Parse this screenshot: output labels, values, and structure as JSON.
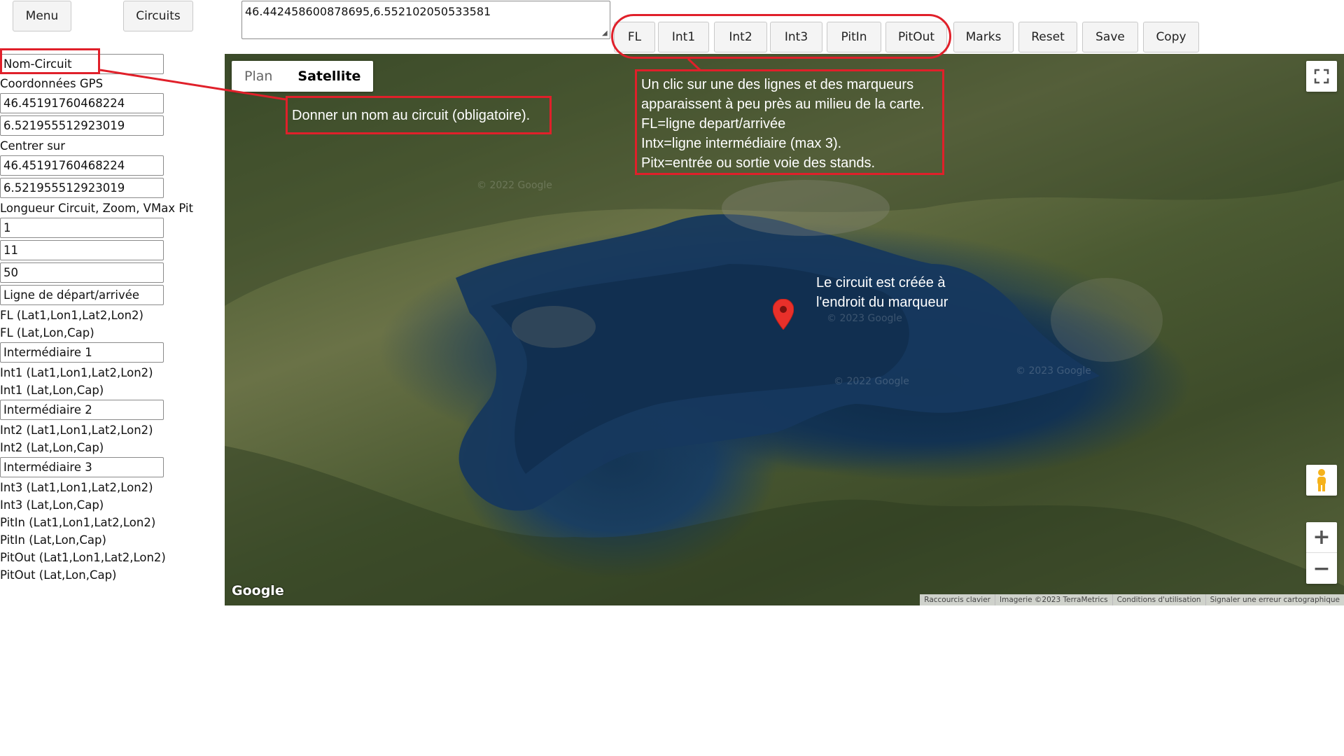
{
  "top_bar": {
    "menu_label": "Menu",
    "circuits_label": "Circuits",
    "coords_value": "46.442458600878695,6.552102050533581",
    "line_buttons": [
      "FL",
      "Int1",
      "Int2",
      "Int3",
      "PitIn",
      "PitOut"
    ],
    "action_buttons": [
      "Marks",
      "Reset",
      "Save",
      "Copy"
    ]
  },
  "sidebar": {
    "name_field": "Nom-Circuit",
    "gps_label": "Coordonnées GPS",
    "gps_lat": "46.45191760468224",
    "gps_lon": "6.521955512923019",
    "center_label": "Centrer sur",
    "center_lat": "46.45191760468224",
    "center_lon": "6.521955512923019",
    "params_label": "Longueur Circuit, Zoom, VMax Pit",
    "length": "1",
    "zoom": "11",
    "vmax": "50",
    "fl_field": "Ligne de départ/arrivée",
    "fl_line": "FL (Lat1,Lon1,Lat2,Lon2)",
    "fl_point": "FL (Lat,Lon,Cap)",
    "int1_field": "Intermédiaire 1",
    "int1_line": "Int1 (Lat1,Lon1,Lat2,Lon2)",
    "int1_point": "Int1 (Lat,Lon,Cap)",
    "int2_field": "Intermédiaire 2",
    "int2_line": "Int2 (Lat1,Lon1,Lat2,Lon2)",
    "int2_point": "Int2 (Lat,Lon,Cap)",
    "int3_field": "Intermédiaire 3",
    "int3_line": "Int3 (Lat1,Lon1,Lat2,Lon2)",
    "int3_point": "Int3 (Lat,Lon,Cap)",
    "pitin_line": "PitIn (Lat1,Lon1,Lat2,Lon2)",
    "pitin_point": "PitIn (Lat,Lon,Cap)",
    "pitout_line": "PitOut (Lat1,Lon1,Lat2,Lon2)",
    "pitout_point": "PitOut (Lat,Lon,Cap)"
  },
  "map": {
    "type_plan": "Plan",
    "type_satellite": "Satellite",
    "active_type": "Satellite",
    "google_logo": "Google",
    "attribution": [
      "Raccourcis clavier",
      "Imagerie ©2023 TerraMetrics",
      "Conditions d'utilisation",
      "Signaler une erreur cartographique"
    ],
    "watermarks": [
      "© 2023 Google",
      "© 2023 Google",
      "© 2022 Google",
      "© 2022 Google"
    ],
    "marker_color": "#e8302a",
    "marker_note_1": "Le circuit est créée à",
    "marker_note_2": "l'endroit du marqueur"
  },
  "annotations": {
    "accent_color": "#e0202a",
    "name_hint": "Donner un nom au circuit (obligatoire).",
    "buttons_hint": [
      "Un clic sur une des lignes et des marqueurs",
      "apparaissent à peu près au milieu de la carte.",
      "FL=ligne depart/arrivée",
      "Intx=ligne intermédiaire (max 3).",
      "Pitx=entrée ou sortie voie des stands."
    ]
  }
}
